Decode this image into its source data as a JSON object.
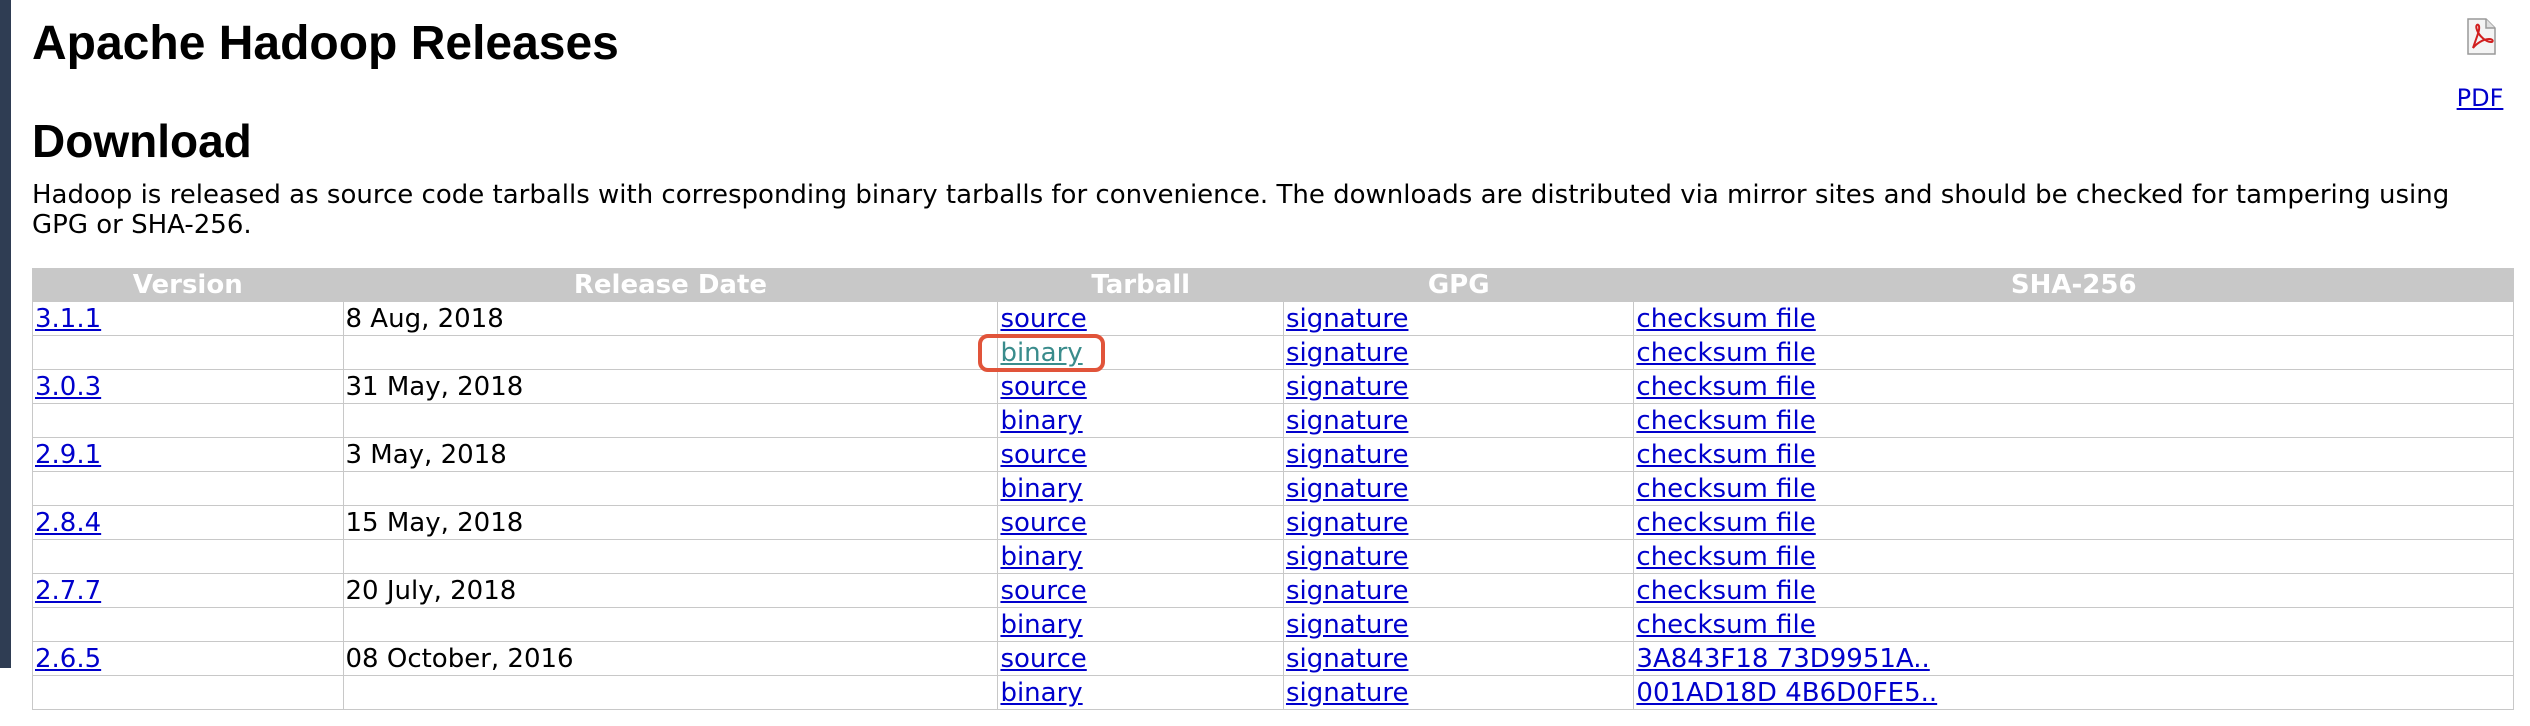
{
  "page": {
    "title": "Apache Hadoop Releases",
    "section_title": "Download",
    "intro": "Hadoop is released as source code tarballs with corresponding binary tarballs for convenience. The downloads are distributed via mirror sites and should be checked for tampering using GPG or SHA-256.",
    "pdf_label": "PDF"
  },
  "table": {
    "headers": {
      "version": "Version",
      "release_date": "Release Date",
      "tarball": "Tarball",
      "gpg": "GPG",
      "sha": "SHA-256"
    },
    "rows": [
      {
        "version": "3.1.1",
        "date": "8 Aug, 2018",
        "tarball": "source",
        "gpg": "signature",
        "sha": "checksum file"
      },
      {
        "version": "",
        "date": "",
        "tarball": "binary",
        "gpg": "signature",
        "sha": "checksum file"
      },
      {
        "version": "3.0.3",
        "date": "31 May, 2018",
        "tarball": "source",
        "gpg": "signature",
        "sha": "checksum file"
      },
      {
        "version": "",
        "date": "",
        "tarball": "binary",
        "gpg": "signature",
        "sha": "checksum file"
      },
      {
        "version": "2.9.1",
        "date": "3 May, 2018",
        "tarball": "source",
        "gpg": "signature",
        "sha": "checksum file"
      },
      {
        "version": "",
        "date": "",
        "tarball": "binary",
        "gpg": "signature",
        "sha": "checksum file"
      },
      {
        "version": "2.8.4",
        "date": "15 May, 2018",
        "tarball": "source",
        "gpg": "signature",
        "sha": "checksum file"
      },
      {
        "version": "",
        "date": "",
        "tarball": "binary",
        "gpg": "signature",
        "sha": "checksum file"
      },
      {
        "version": "2.7.7",
        "date": "20 July, 2018",
        "tarball": "source",
        "gpg": "signature",
        "sha": "checksum file"
      },
      {
        "version": "",
        "date": "",
        "tarball": "binary",
        "gpg": "signature",
        "sha": "checksum file"
      },
      {
        "version": "2.6.5",
        "date": "08 October, 2016",
        "tarball": "source",
        "gpg": "signature",
        "sha": "3A843F18 73D9951A.."
      },
      {
        "version": "",
        "date": "",
        "tarball": "binary",
        "gpg": "signature",
        "sha": "001AD18D 4B6D0FE5.."
      }
    ]
  },
  "icons": {
    "pdf": "pdf-document-icon"
  },
  "colors": {
    "link": "#0000cc",
    "visited_link": "#3a8c8c",
    "header_bg": "#c8c8c8",
    "highlight": "#e1543a",
    "left_strip": "#2f3d53"
  }
}
